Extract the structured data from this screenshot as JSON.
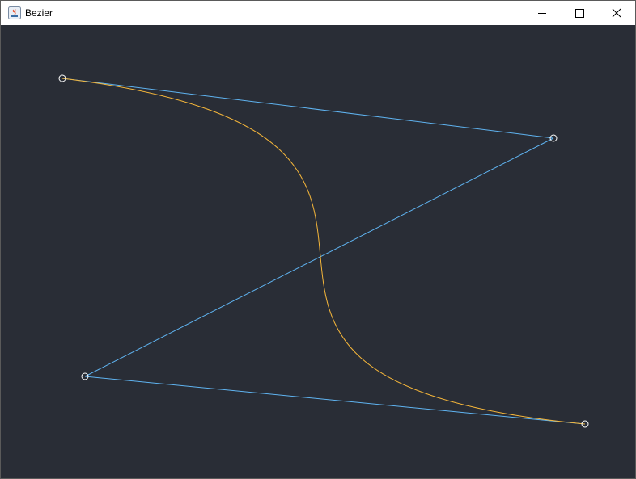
{
  "window": {
    "title": "Bezier",
    "icons": {
      "app": "java-app-icon",
      "minimize": "minimize-icon",
      "maximize": "maximize-icon",
      "close": "close-icon"
    }
  },
  "canvas": {
    "background": "#292d36",
    "control_polygon_color": "#5fb3f0",
    "curve_color": "#f5b63a",
    "handle_color": "#ffffff"
  }
}
